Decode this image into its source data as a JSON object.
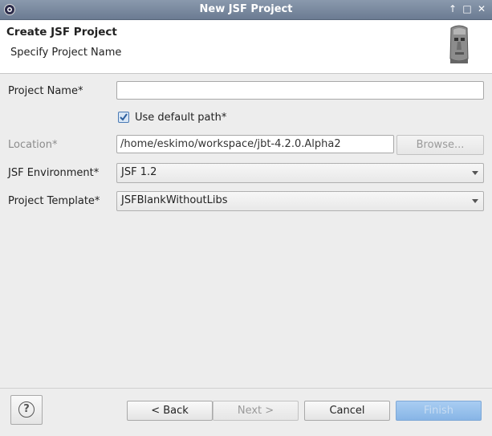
{
  "window": {
    "title": "New JSF Project",
    "controls": [
      "up-arrow-icon",
      "maximize-icon",
      "close-icon"
    ]
  },
  "header": {
    "title": "Create JSF Project",
    "subtitle": "Specify Project Name"
  },
  "form": {
    "project_name_label": "Project Name*",
    "project_name_value": "",
    "use_default_label": "Use default path*",
    "use_default_checked": true,
    "location_label": "Location*",
    "location_value": "/home/eskimo/workspace/jbt-4.2.0.Alpha2",
    "browse_label": "Browse...",
    "jsf_env_label": "JSF Environment*",
    "jsf_env_value": "JSF 1.2",
    "template_label": "Project Template*",
    "template_value": "JSFBlankWithoutLibs"
  },
  "footer": {
    "back_label": "< Back",
    "next_label": "Next >",
    "cancel_label": "Cancel",
    "finish_label": "Finish"
  }
}
